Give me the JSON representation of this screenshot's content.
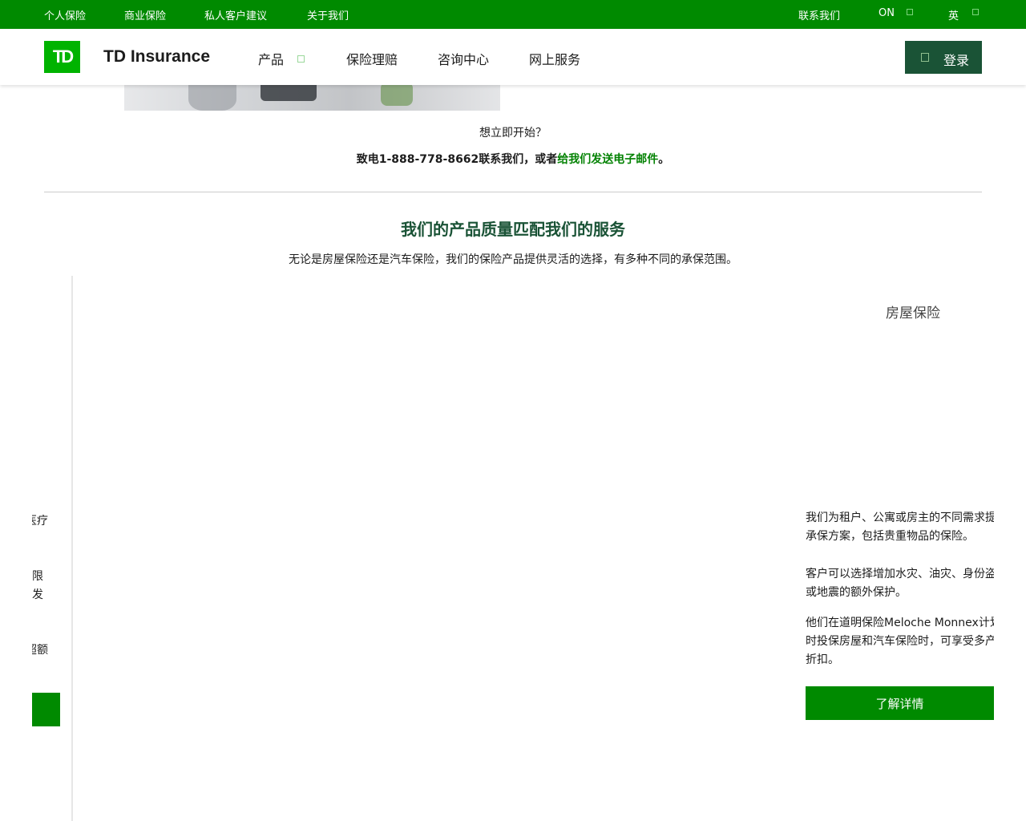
{
  "topbar": {
    "links": [
      "个人保险",
      "商业保险",
      "私人客户建议",
      "关于我们"
    ],
    "contact": "联系我们",
    "province": "ON",
    "language": "英"
  },
  "navbar": {
    "logo_text": "TD",
    "brand": "TD Insurance",
    "items": [
      "产品",
      "保险理赔",
      "咨询中心",
      "网上服务"
    ],
    "login": "登录"
  },
  "cta": {
    "question": "想立即开始？",
    "call_text": "致电1-888-778-8662联系我们，或者",
    "email_link": "给我们发送电子邮件",
    "end_punct": "。"
  },
  "section": {
    "title": "我们的产品质量匹配我们的服务",
    "subtitle": "无论是房屋保险还是汽车保险，我们的保险产品提供灵活的选择，有多种不同的承保范围。"
  },
  "left_card_fragments": [
    "医疗",
    "限",
    "发",
    "超额"
  ],
  "home_card": {
    "title": "房屋保险",
    "para1": "我们为租户、公寓或房主的不同需求提供承保方案，包括贵重物品的保险。",
    "para2": "客户可以选择增加水灾、油灾、身份盗窃或地震的额外保护。",
    "para3": "他们在道明保险Meloche Monnex计划同时投保房屋和汽车保险时，可享受多产品折扣。",
    "button": "了解详情"
  },
  "colors": {
    "brand_green": "#008a00",
    "dark_green": "#1a5336",
    "logo_green": "#00b300",
    "link_green": "#038203"
  }
}
